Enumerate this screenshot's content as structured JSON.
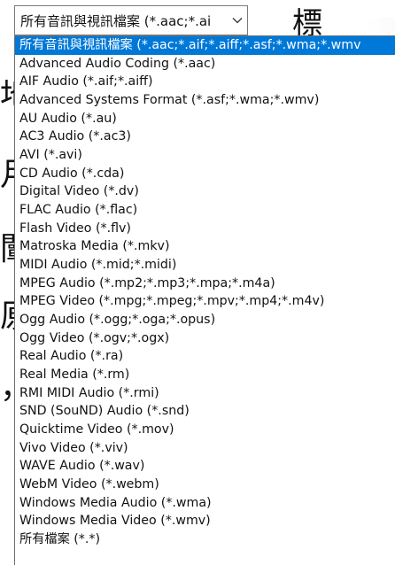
{
  "window": {
    "title": ""
  },
  "combo": {
    "selected": "所有音訊與視訊檔案 (*.aac;*.ai"
  },
  "options": [
    {
      "label": "所有音訊與視訊檔案 (*.aac;*.aif;*.aiff;*.asf;*.wma;*.wmv",
      "selected": true
    },
    {
      "label": "Advanced Audio Coding (*.aac)"
    },
    {
      "label": "AIF Audio (*.aif;*.aiff)"
    },
    {
      "label": "Advanced Systems Format (*.asf;*.wma;*.wmv)"
    },
    {
      "label": "AU Audio (*.au)"
    },
    {
      "label": "AC3 Audio (*.ac3)"
    },
    {
      "label": "AVI (*.avi)"
    },
    {
      "label": "CD Audio (*.cda)"
    },
    {
      "label": "Digital Video (*.dv)"
    },
    {
      "label": "FLAC Audio (*.flac)"
    },
    {
      "label": "Flash Video (*.flv)"
    },
    {
      "label": "Matroska Media (*.mkv)"
    },
    {
      "label": "MIDI Audio (*.mid;*.midi)"
    },
    {
      "label": "MPEG Audio (*.mp2;*.mp3;*.mpa;*.m4a)"
    },
    {
      "label": "MPEG Video (*.mpg;*.mpeg;*.mpv;*.mp4;*.m4v)"
    },
    {
      "label": "Ogg Audio (*.ogg;*.oga;*.opus)"
    },
    {
      "label": "Ogg Video (*.ogv;*.ogx)"
    },
    {
      "label": "Real Audio (*.ra)"
    },
    {
      "label": "Real Media (*.rm)"
    },
    {
      "label": "RMI MIDI Audio (*.rmi)"
    },
    {
      "label": "SND (SouND) Audio (*.snd)"
    },
    {
      "label": "Quicktime Video (*.mov)"
    },
    {
      "label": "Vivo Video (*.viv)"
    },
    {
      "label": "WAVE Audio (*.wav)"
    },
    {
      "label": "WebM Video (*.webm)"
    },
    {
      "label": "Windows Media Audio (*.wma)"
    },
    {
      "label": "Windows Media Video (*.wmv)"
    },
    {
      "label": "所有檔案 (*.*)"
    }
  ],
  "background_text": {
    "glyph_top": "標",
    "glyph_1": "地",
    "glyph_2": "月",
    "glyph_3": "闡",
    "glyph_4": "原",
    "glyph_5": "，"
  },
  "colors": {
    "selection": "#0078d7",
    "border": "#7a7a7a"
  },
  "icons": {
    "dropdown": "chevron-down-icon"
  }
}
